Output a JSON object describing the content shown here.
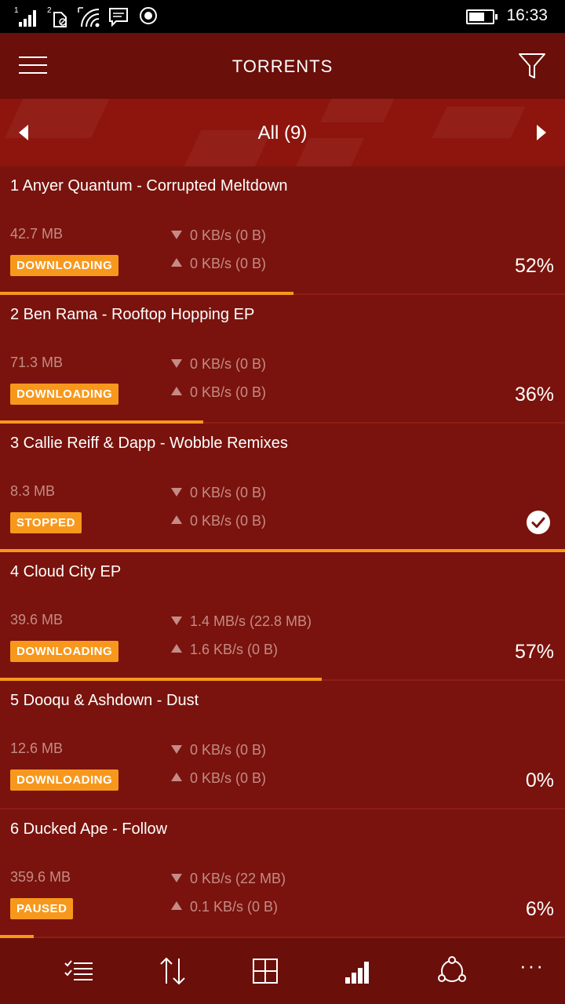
{
  "status_bar": {
    "sim1": "1",
    "sim2": "2",
    "time": "16:33"
  },
  "header": {
    "title": "TORRENTS"
  },
  "pivot": {
    "label": "All (9)"
  },
  "torrents": [
    {
      "name": "1 Anyer Quantum - Corrupted Meltdown",
      "size": "42.7 MB",
      "down": "0 KB/s (0 B)",
      "up": "0 KB/s (0 B)",
      "status": "DOWNLOADING",
      "percent": "52%",
      "progress": 0.52
    },
    {
      "name": "2 Ben Rama - Rooftop Hopping EP",
      "size": "71.3 MB",
      "down": "0 KB/s (0 B)",
      "up": "0 KB/s (0 B)",
      "status": "DOWNLOADING",
      "percent": "36%",
      "progress": 0.36
    },
    {
      "name": "3 Callie Reiff & Dapp - Wobble Remixes",
      "size": "8.3 MB",
      "down": "0 KB/s (0 B)",
      "up": "0 KB/s (0 B)",
      "status": "STOPPED",
      "percent": "",
      "progress": 1.0
    },
    {
      "name": "4 Cloud City EP",
      "size": "39.6 MB",
      "down": "1.4 MB/s (22.8 MB)",
      "up": "1.6 KB/s (0 B)",
      "status": "DOWNLOADING",
      "percent": "57%",
      "progress": 0.57
    },
    {
      "name": "5 Dooqu & Ashdown - Dust",
      "size": "12.6 MB",
      "down": "0 KB/s (0 B)",
      "up": "0 KB/s (0 B)",
      "status": "DOWNLOADING",
      "percent": "0%",
      "progress": 0.0
    },
    {
      "name": "6 Ducked Ape - Follow",
      "size": "359.6 MB",
      "down": "0 KB/s (22 MB)",
      "up": "0.1 KB/s (0 B)",
      "status": "PAUSED",
      "percent": "6%",
      "progress": 0.06
    }
  ],
  "app_bar": {
    "more": "···"
  },
  "colors": {
    "background": "#7a130d",
    "header": "#6a0f0a",
    "pivot": "#8d150d",
    "accent": "#f7981d",
    "muted_text": "#c58b86"
  },
  "icons": [
    "signal-icon",
    "sim2-icon",
    "wifi-icon",
    "message-icon",
    "record-icon",
    "battery-icon",
    "hamburger-icon",
    "filter-icon",
    "chevron-left-icon",
    "chevron-right-icon",
    "check-circle-icon",
    "checklist-icon",
    "sort-icon",
    "grid-icon",
    "signal-bars-icon",
    "share-icon",
    "more-icon"
  ]
}
